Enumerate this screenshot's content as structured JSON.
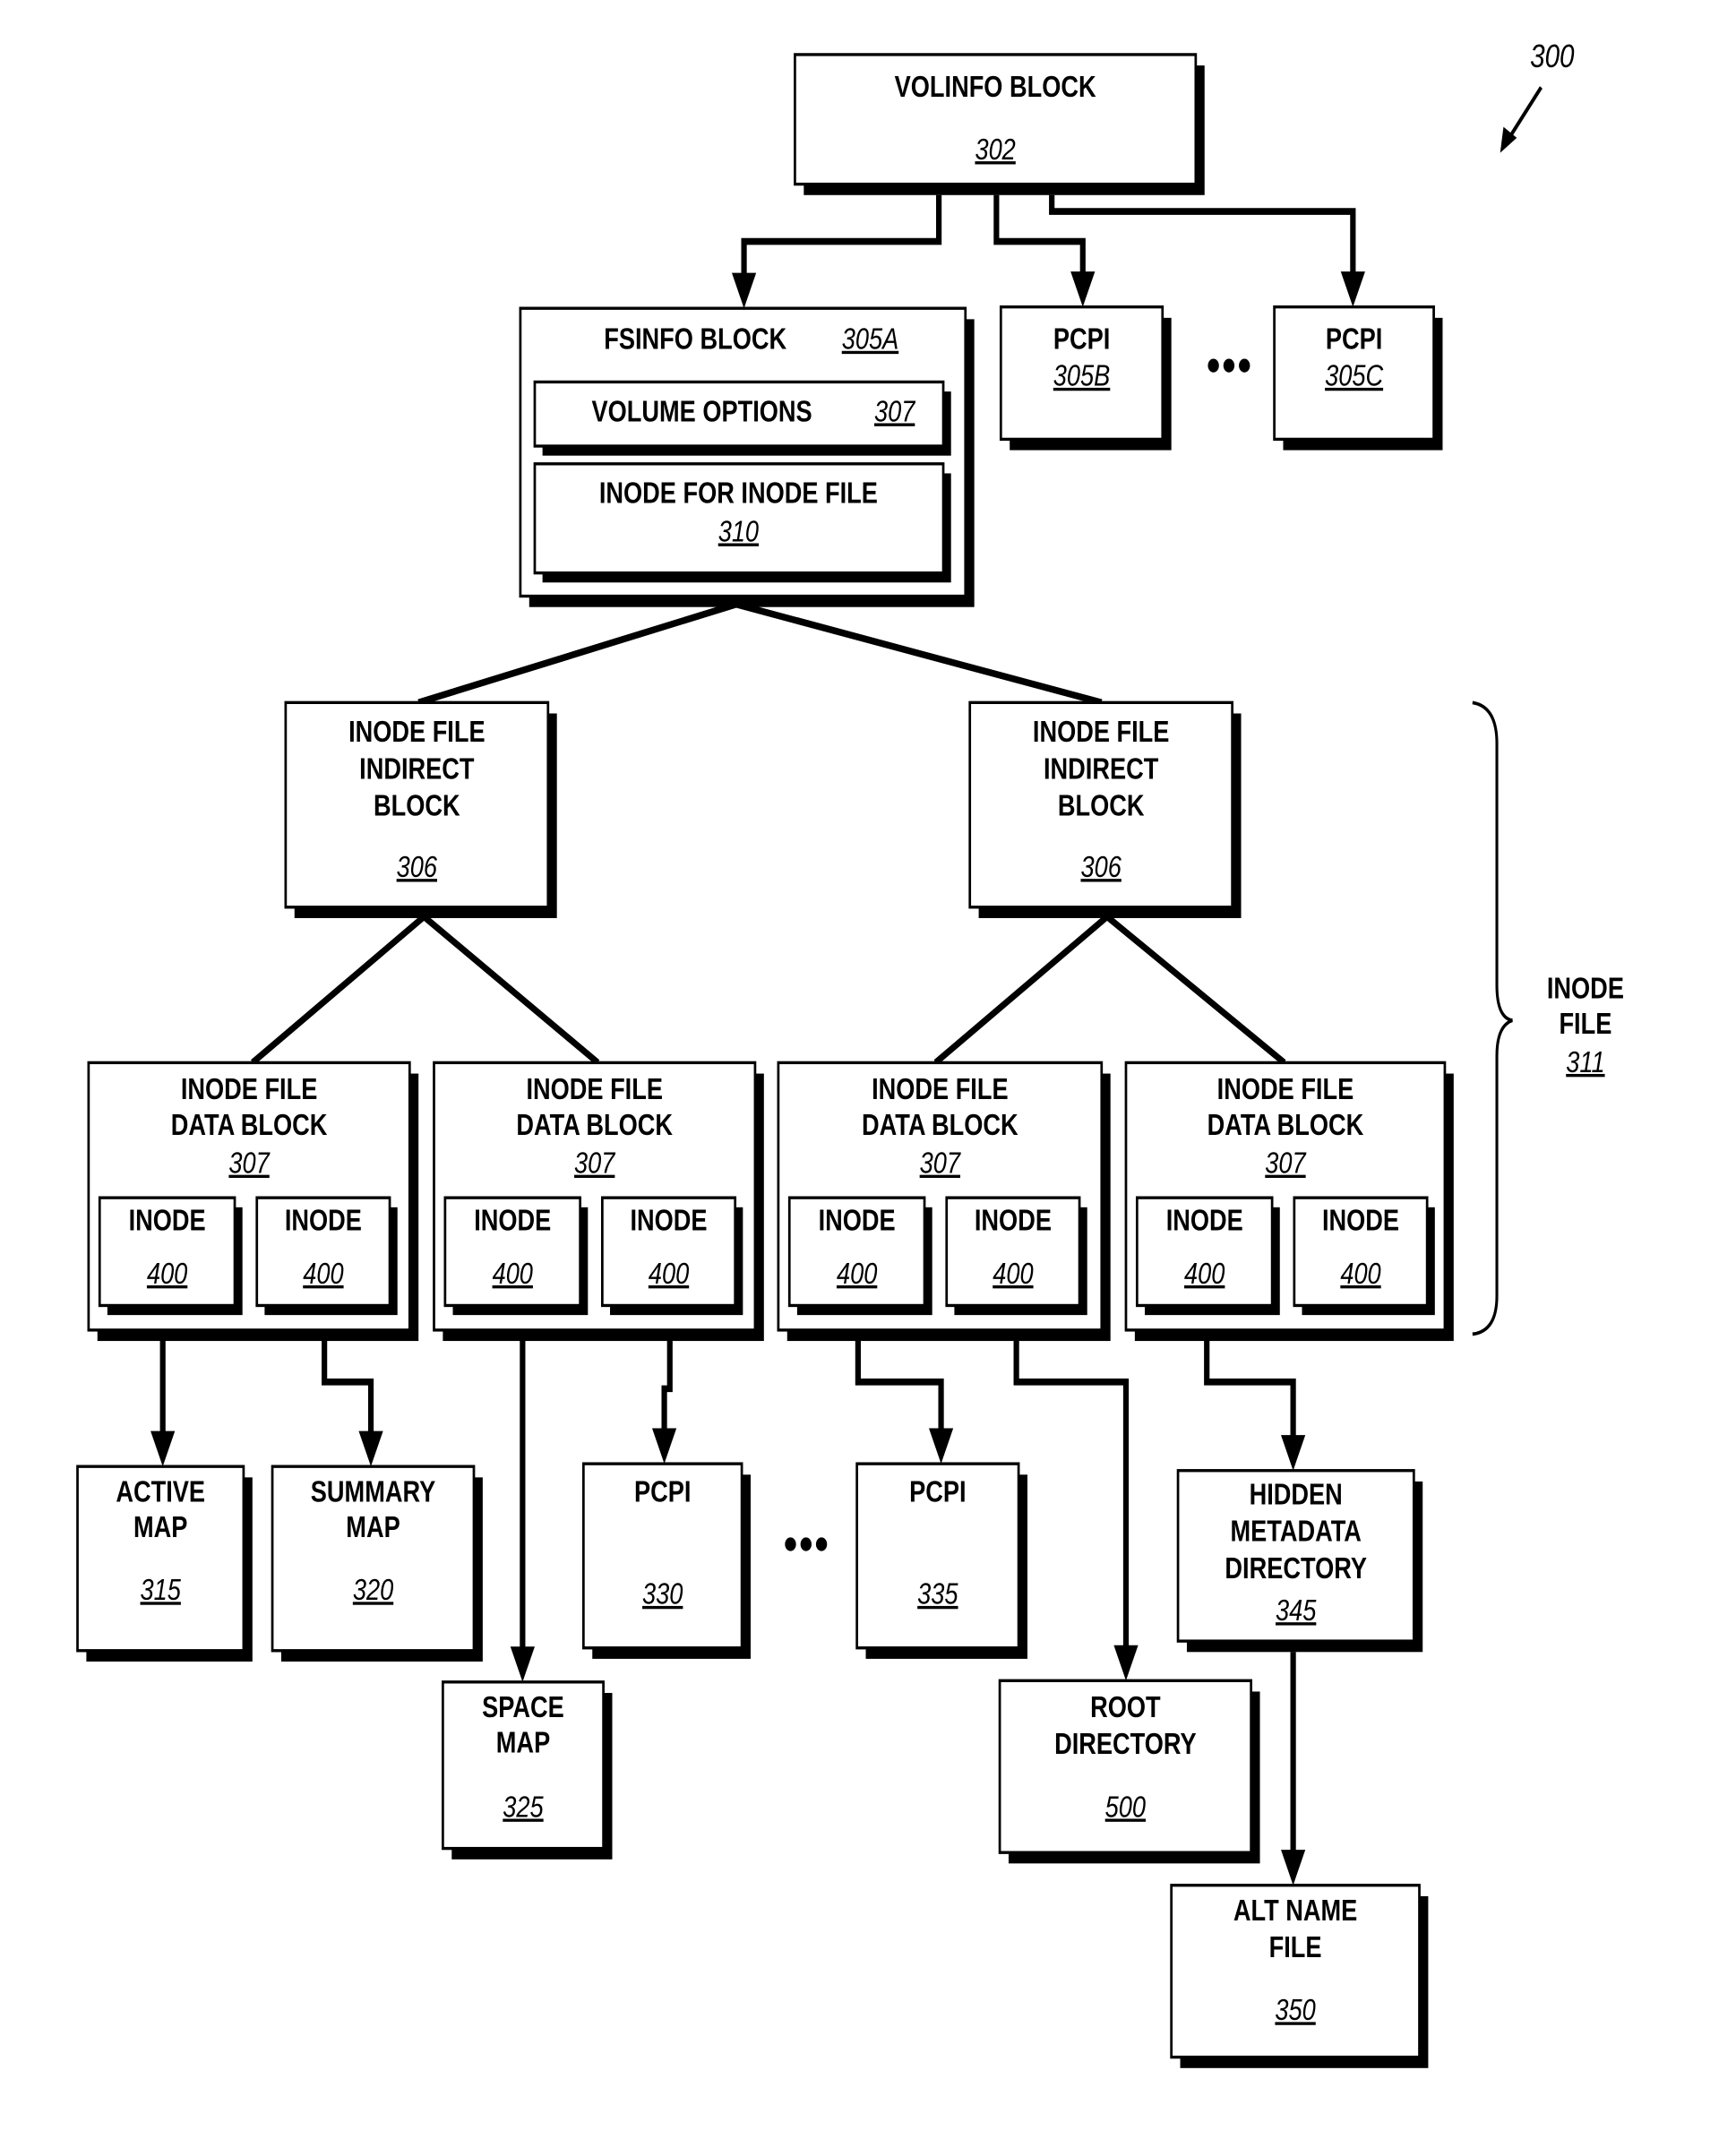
{
  "figure": {
    "ref": "300",
    "accent_color": "#000000",
    "background_color": "#ffffff"
  },
  "volinfo": {
    "title": "VOLINFO BLOCK",
    "ref": "302"
  },
  "fsinfo": {
    "title": "FSINFO BLOCK",
    "ref": "305A",
    "volume_options": {
      "title": "VOLUME OPTIONS",
      "ref": "307"
    },
    "inode_for_inode_file": {
      "title": "INODE FOR INODE FILE",
      "ref": "310"
    }
  },
  "pcpi_top": [
    {
      "title": "PCPI",
      "ref": "305B"
    },
    {
      "title": "PCPI",
      "ref": "305C"
    }
  ],
  "indirect_blocks": [
    {
      "lines": [
        "INODE FILE",
        "INDIRECT",
        "BLOCK"
      ],
      "ref": "306"
    },
    {
      "lines": [
        "INODE FILE",
        "INDIRECT",
        "BLOCK"
      ],
      "ref": "306"
    }
  ],
  "data_blocks": [
    {
      "lines": [
        "INODE FILE",
        "DATA BLOCK"
      ],
      "ref": "307",
      "inodes": [
        {
          "title": "INODE",
          "ref": "400"
        },
        {
          "title": "INODE",
          "ref": "400"
        }
      ]
    },
    {
      "lines": [
        "INODE FILE",
        "DATA BLOCK"
      ],
      "ref": "307",
      "inodes": [
        {
          "title": "INODE",
          "ref": "400"
        },
        {
          "title": "INODE",
          "ref": "400"
        }
      ]
    },
    {
      "lines": [
        "INODE FILE",
        "DATA BLOCK"
      ],
      "ref": "307",
      "inodes": [
        {
          "title": "INODE",
          "ref": "400"
        },
        {
          "title": "INODE",
          "ref": "400"
        }
      ]
    },
    {
      "lines": [
        "INODE FILE",
        "DATA BLOCK"
      ],
      "ref": "307",
      "inodes": [
        {
          "title": "INODE",
          "ref": "400"
        },
        {
          "title": "INODE",
          "ref": "400"
        }
      ]
    }
  ],
  "inode_file_brace": {
    "lines": [
      "INODE",
      "FILE"
    ],
    "ref": "311"
  },
  "leaf_blocks": [
    {
      "id": "active-map",
      "lines": [
        "ACTIVE",
        "MAP"
      ],
      "ref": "315"
    },
    {
      "id": "summary-map",
      "lines": [
        "SUMMARY",
        "MAP"
      ],
      "ref": "320"
    },
    {
      "id": "space-map",
      "lines": [
        "SPACE",
        "MAP"
      ],
      "ref": "325"
    },
    {
      "id": "pcpi-330",
      "lines": [
        "PCPI"
      ],
      "ref": "330"
    },
    {
      "id": "pcpi-335",
      "lines": [
        "PCPI"
      ],
      "ref": "335"
    },
    {
      "id": "root-directory",
      "lines": [
        "ROOT",
        "DIRECTORY"
      ],
      "ref": "500"
    },
    {
      "id": "hidden-metadata-directory",
      "lines": [
        "HIDDEN",
        "METADATA",
        "DIRECTORY"
      ],
      "ref": "345"
    },
    {
      "id": "alt-name-file",
      "lines": [
        "ALT NAME",
        "FILE"
      ],
      "ref": "350"
    }
  ],
  "ellipsis": "•••"
}
